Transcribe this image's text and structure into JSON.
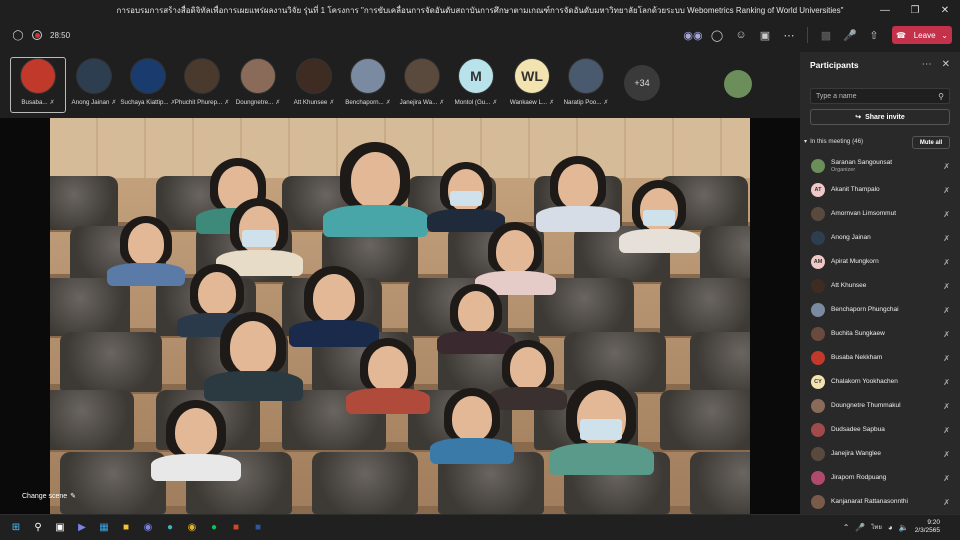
{
  "window": {
    "title": "การอบรมการสร้างสื่อดิจิทัลเพื่อการเผยแพร่ผลงานวิจัย รุ่นที่ 1 โครงการ \"การขับเคลื่อนการจัดอันดับสถาบันการศึกษาตามเกณฑ์การจัดอันดับมหาวิทยาลัยโลกด้วยระบบ Webometrics Ranking of World Universities\""
  },
  "toolbar": {
    "timer": "28:50",
    "leave_label": "Leave",
    "icons": [
      "people-icon",
      "chat-icon",
      "reactions-icon",
      "rooms-icon",
      "more-icon",
      "camera-icon",
      "mic-icon",
      "share-icon"
    ]
  },
  "strip": {
    "participants": [
      {
        "name": "Busaba...",
        "selected": true,
        "color": "#c0392b"
      },
      {
        "name": "Anong Jainan",
        "color": "#2c3e50"
      },
      {
        "name": "Suchaya Kiattip...",
        "color": "#1a3b6e"
      },
      {
        "name": "Phuchit Phurep...",
        "color": "#4a3a2e"
      },
      {
        "name": "Doungnetre...",
        "color": "#8a6b5a"
      },
      {
        "name": "Att Khunsee",
        "color": "#3e2c22"
      },
      {
        "name": "Benchaporn...",
        "color": "#7a8aa0"
      },
      {
        "name": "Janejira Wa...",
        "color": "#5a4a3e"
      },
      {
        "name": "Montol (Gu...",
        "initials": "M",
        "color": "#b9e3ea"
      },
      {
        "name": "Wankaew L...",
        "initials": "WL",
        "color": "#f3e3b0"
      },
      {
        "name": "Naratip Poo...",
        "color": "#4a5a6e"
      }
    ],
    "more_count": "+34"
  },
  "stage": {
    "change_scene_label": "Change scene"
  },
  "panel": {
    "title": "Participants",
    "search_placeholder": "Type a name",
    "share_invite_label": "Share invite",
    "in_meeting_label": "In this meeting (46)",
    "mute_all_label": "Mute all",
    "people": [
      {
        "name": "Saranan Sangounsat",
        "role": "Organizer",
        "color": "#6b8e5a"
      },
      {
        "name": "Akanit Thampalo",
        "initials": "AT",
        "color": "#f0c8c8"
      },
      {
        "name": "Amornvan Limsommut",
        "color": "#5a4a3e"
      },
      {
        "name": "Anong Jainan",
        "color": "#2c3e50"
      },
      {
        "name": "Apirat Mungkorn",
        "initials": "AM",
        "color": "#f0c8c8"
      },
      {
        "name": "Att Khunsee",
        "color": "#3e2c22"
      },
      {
        "name": "Benchaporn Phungchai",
        "color": "#7a8aa0"
      },
      {
        "name": "Buchita Sungkaew",
        "color": "#6a4a3e"
      },
      {
        "name": "Busaba Nekkham",
        "color": "#c0392b"
      },
      {
        "name": "Chalakorn Yookhachen",
        "initials": "CY",
        "color": "#f3e3b0"
      },
      {
        "name": "Doungnetre Thummakul",
        "color": "#8a6b5a"
      },
      {
        "name": "Dudsadee Sapbua",
        "color": "#a04a4a"
      },
      {
        "name": "Janejira Wanglee",
        "color": "#5a4a3e"
      },
      {
        "name": "Jiraporn Rodpuang",
        "color": "#b04a6a"
      },
      {
        "name": "Kanjanarat Rattanasonnthi",
        "color": "#7a5a48"
      }
    ]
  },
  "taskbar": {
    "time": "9:20",
    "date": "2/3/2565",
    "lang": "ไทย"
  },
  "colors": {
    "leave": "#c4314b",
    "panel_bg": "#292929",
    "window_bg": "#1f1f1f"
  }
}
